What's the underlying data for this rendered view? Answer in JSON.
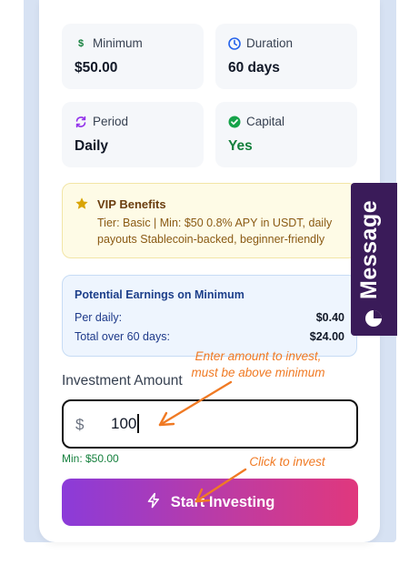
{
  "stats": {
    "minimum": {
      "label": "Minimum",
      "value": "$50.00",
      "icon": "dollar-icon"
    },
    "duration": {
      "label": "Duration",
      "value": "60 days",
      "icon": "clock-icon"
    },
    "period": {
      "label": "Period",
      "value": "Daily",
      "icon": "refresh-icon"
    },
    "capital": {
      "label": "Capital",
      "value": "Yes",
      "icon": "check-circle-icon"
    }
  },
  "vip": {
    "title": "VIP Benefits",
    "text": "Tier: Basic | Min: $50 0.8% APY in USDT, daily payouts Stablecoin-backed, beginner-friendly"
  },
  "earnings": {
    "title": "Potential Earnings on Minimum",
    "rows": [
      {
        "label": "Per daily:",
        "value": "$0.40"
      },
      {
        "label": "Total over 60 days:",
        "value": "$24.00"
      }
    ]
  },
  "investment": {
    "label": "Investment Amount",
    "currency_symbol": "$",
    "value": "100",
    "min_note": "Min: $50.00"
  },
  "start_button": {
    "label": "Start Investing",
    "icon": "lightning-icon"
  },
  "message_tab": {
    "label": "Message",
    "icon": "chat-icon"
  },
  "annotations": {
    "amount_hint": "Enter amount to invest, must be above minimum",
    "invest_hint": "Click  to invest"
  },
  "colors": {
    "accent_purple": "#8b3bd9",
    "accent_pink": "#e0387d",
    "success_green": "#15803d",
    "annotation_orange": "#f07a24",
    "message_tab_bg": "#3a1b59"
  }
}
